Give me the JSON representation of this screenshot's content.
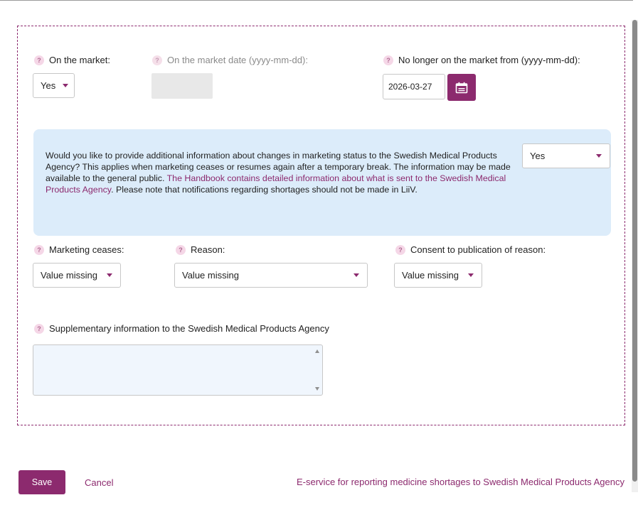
{
  "market": {
    "on_market_label": "On the market:",
    "on_market_value": "Yes",
    "on_market_date_label": "On the market date (yyyy-mm-dd):",
    "on_market_date_value": "",
    "no_longer_label": "No longer on the market from (yyyy-mm-dd):",
    "no_longer_value": "2026-03-27"
  },
  "info": {
    "text_part1": "Would you like to provide additional information about changes in marketing status to the Swedish Medical Products Agency? This applies when marketing ceases or resumes again after a temporary break. The information may be made available to the general public. ",
    "link_text": "The Handbook contains detailed information about what is sent to the Swedish Medical Products Agency",
    "text_part2": ". Please note that notifications regarding shortages should not be made in LiiV.",
    "select_value": "Yes"
  },
  "marketing": {
    "ceases_label": "Marketing ceases:",
    "ceases_value": "Value missing",
    "reason_label": "Reason:",
    "reason_value": "Value missing",
    "consent_label": "Consent to publication of reason:",
    "consent_value": "Value missing"
  },
  "supplementary": {
    "label": "Supplementary information to the Swedish Medical Products Agency",
    "value": ""
  },
  "footer": {
    "save_label": "Save",
    "cancel_label": "Cancel",
    "eservice_label": "E-service for reporting medicine shortages to Swedish Medical Products Agency"
  },
  "icons": {
    "help": "?"
  },
  "colors": {
    "accent": "#8c2a6e",
    "info_background": "#dcecfa",
    "help_icon_background": "#f5d7e7"
  }
}
